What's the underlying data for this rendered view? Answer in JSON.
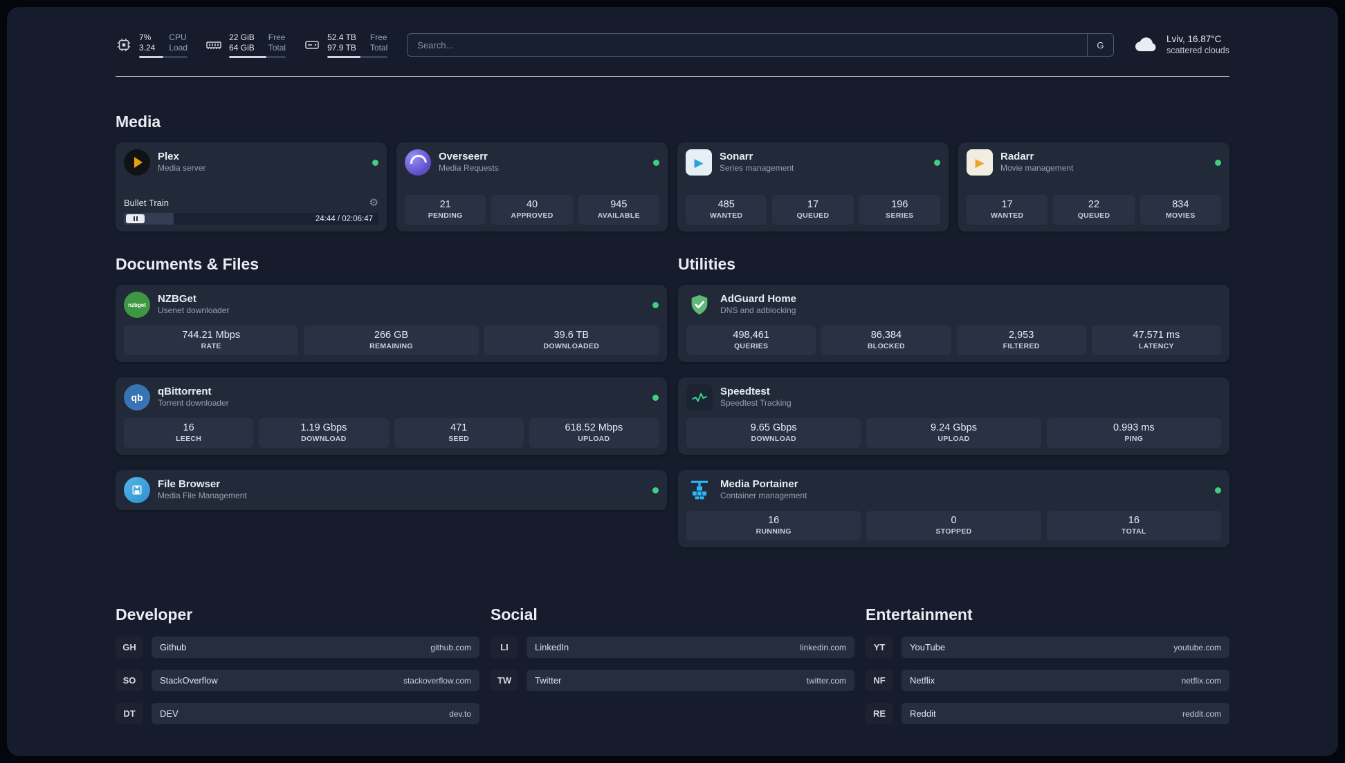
{
  "topbar": {
    "cpu": {
      "value_top": "7%",
      "value_bottom": "3.24",
      "label_top": "CPU",
      "label_bottom": "Load",
      "progress_pct": 50
    },
    "memory": {
      "value_top": "22 GiB",
      "value_bottom": "64 GiB",
      "label_top": "Free",
      "label_bottom": "Total",
      "progress_pct": 66
    },
    "disk": {
      "value_top": "52.4 TB",
      "value_bottom": "97.9 TB",
      "label_top": "Free",
      "label_bottom": "Total",
      "progress_pct": 55
    },
    "search": {
      "placeholder": "Search...",
      "button_label": "G"
    },
    "weather": {
      "location": "Lviv, 16.87°C",
      "condition": "scattered clouds"
    }
  },
  "media": {
    "title": "Media",
    "plex": {
      "title": "Plex",
      "subtitle": "Media server",
      "now_playing": {
        "track": "Bullet Train",
        "time": "24:44 / 02:06:47",
        "progress_pct": 19.5
      }
    },
    "cards": [
      {
        "title": "Overseerr",
        "subtitle": "Media Requests",
        "stats": [
          {
            "value": "21",
            "label": "PENDING"
          },
          {
            "value": "40",
            "label": "APPROVED"
          },
          {
            "value": "945",
            "label": "AVAILABLE"
          }
        ]
      },
      {
        "title": "Sonarr",
        "subtitle": "Series management",
        "stats": [
          {
            "value": "485",
            "label": "WANTED"
          },
          {
            "value": "17",
            "label": "QUEUED"
          },
          {
            "value": "196",
            "label": "SERIES"
          }
        ]
      },
      {
        "title": "Radarr",
        "subtitle": "Movie management",
        "stats": [
          {
            "value": "17",
            "label": "WANTED"
          },
          {
            "value": "22",
            "label": "QUEUED"
          },
          {
            "value": "834",
            "label": "MOVIES"
          }
        ]
      }
    ]
  },
  "documents": {
    "title": "Documents & Files",
    "cards": [
      {
        "title": "NZBGet",
        "subtitle": "Usenet downloader",
        "stats": [
          {
            "value": "744.21 Mbps",
            "label": "RATE"
          },
          {
            "value": "266 GB",
            "label": "REMAINING"
          },
          {
            "value": "39.6 TB",
            "label": "DOWNLOADED"
          }
        ]
      },
      {
        "title": "qBittorrent",
        "subtitle": "Torrent downloader",
        "stats": [
          {
            "value": "16",
            "label": "LEECH"
          },
          {
            "value": "1.19 Gbps",
            "label": "DOWNLOAD"
          },
          {
            "value": "471",
            "label": "SEED"
          },
          {
            "value": "618.52 Mbps",
            "label": "UPLOAD"
          }
        ]
      },
      {
        "title": "File Browser",
        "subtitle": "Media File Management",
        "stats": []
      }
    ]
  },
  "utilities": {
    "title": "Utilities",
    "cards": [
      {
        "title": "AdGuard Home",
        "subtitle": "DNS and adblocking",
        "stats": [
          {
            "value": "498,461",
            "label": "QUERIES"
          },
          {
            "value": "86,384",
            "label": "BLOCKED"
          },
          {
            "value": "2,953",
            "label": "FILTERED"
          },
          {
            "value": "47.571 ms",
            "label": "LATENCY"
          }
        ]
      },
      {
        "title": "Speedtest",
        "subtitle": "Speedtest Tracking",
        "stats": [
          {
            "value": "9.65 Gbps",
            "label": "DOWNLOAD"
          },
          {
            "value": "9.24 Gbps",
            "label": "UPLOAD"
          },
          {
            "value": "0.993 ms",
            "label": "PING"
          }
        ]
      },
      {
        "title": "Media Portainer",
        "subtitle": "Container management",
        "stats": [
          {
            "value": "16",
            "label": "RUNNING"
          },
          {
            "value": "0",
            "label": "STOPPED"
          },
          {
            "value": "16",
            "label": "TOTAL"
          }
        ]
      }
    ]
  },
  "bookmarks": {
    "developer": {
      "title": "Developer",
      "items": [
        {
          "abbr": "GH",
          "name": "Github",
          "url": "github.com"
        },
        {
          "abbr": "SO",
          "name": "StackOverflow",
          "url": "stackoverflow.com"
        },
        {
          "abbr": "DT",
          "name": "DEV",
          "url": "dev.to"
        }
      ]
    },
    "social": {
      "title": "Social",
      "items": [
        {
          "abbr": "LI",
          "name": "LinkedIn",
          "url": "linkedin.com"
        },
        {
          "abbr": "TW",
          "name": "Twitter",
          "url": "twitter.com"
        }
      ]
    },
    "entertainment": {
      "title": "Entertainment",
      "items": [
        {
          "abbr": "YT",
          "name": "YouTube",
          "url": "youtube.com"
        },
        {
          "abbr": "NF",
          "name": "Netflix",
          "url": "netflix.com"
        },
        {
          "abbr": "RE",
          "name": "Reddit",
          "url": "reddit.com"
        }
      ]
    }
  },
  "icons": {
    "cpu": "chip",
    "memory": "ram-stick",
    "disk": "hard-drive",
    "search_button": "G",
    "weather": "cloud",
    "plex": "chevron-right",
    "overseerr": "swirl",
    "sonarr": "play",
    "radarr": "play",
    "nzbget": "nzbget-badge",
    "qbittorrent": "qb-badge",
    "filebrowser": "floppy",
    "adguard": "shield-check",
    "speedtest": "line-chart",
    "portainer": "crane",
    "settings": "gear",
    "pause": "pause-bars",
    "status": "green-dot"
  },
  "colors": {
    "background": "#161c2c",
    "card": "#222939",
    "stat_box": "#2a3144",
    "status_ok": "#3fce82",
    "plex_amber": "#e5a00d",
    "sonarr_blue": "#2aa3dd",
    "radarr_amber": "#f0a22e",
    "nzbget_green": "#3f9643",
    "qbittorrent_blue": "#3873b3",
    "filebrowser_blue": "#2d8fd1",
    "adguard_green": "#5fb875",
    "speedtest_green": "#39d98a",
    "portainer_blue": "#29b8f5"
  }
}
